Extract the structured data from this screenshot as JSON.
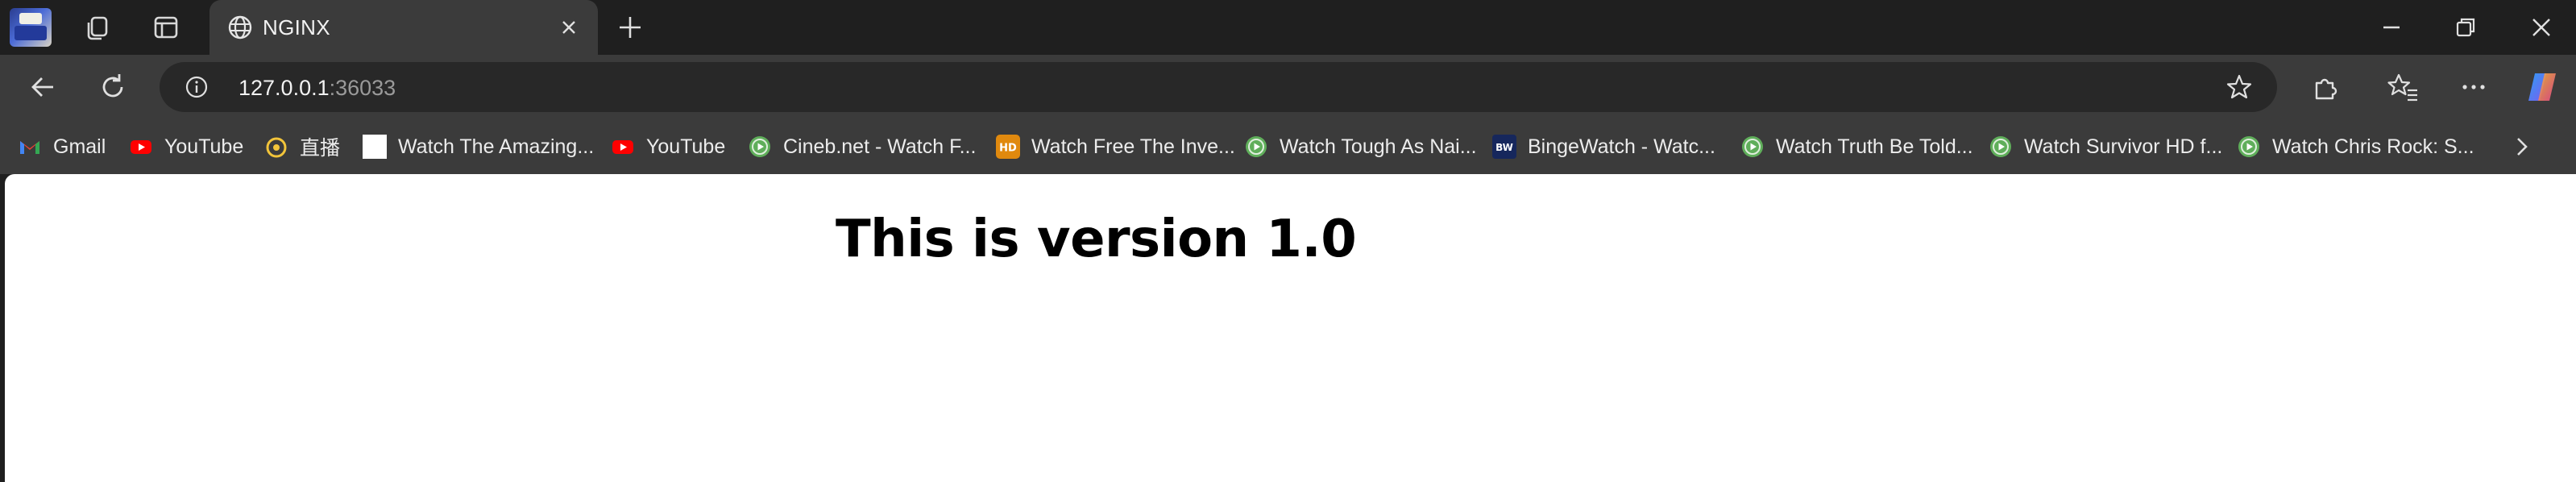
{
  "browser": {
    "tabs": [
      {
        "title": "NGINX",
        "active": true
      }
    ],
    "address_bar": {
      "host": "127.0.0.1",
      "port": ":36033"
    },
    "bookmarks": [
      {
        "label": "Gmail",
        "icon": "gmail-icon"
      },
      {
        "label": "YouTube",
        "icon": "youtube-icon"
      },
      {
        "label": "直播",
        "icon": "live-stream-icon"
      },
      {
        "label": "Watch The Amazing...",
        "icon": "blank-page-icon"
      },
      {
        "label": "YouTube",
        "icon": "youtube-icon"
      },
      {
        "label": "Cineb.net - Watch F...",
        "icon": "play-circle-icon"
      },
      {
        "label": "Watch Free The Inve...",
        "icon": "hd-icon",
        "badge": "HD"
      },
      {
        "label": "Watch Tough As Nai...",
        "icon": "play-circle-icon"
      },
      {
        "label": "BingeWatch - Watc...",
        "icon": "bingewatch-icon",
        "badge": "BW"
      },
      {
        "label": "Watch Truth Be Told...",
        "icon": "play-circle-icon"
      },
      {
        "label": "Watch Survivor HD f...",
        "icon": "play-circle-icon"
      },
      {
        "label": "Watch Chris Rock: S...",
        "icon": "play-circle-icon"
      }
    ]
  },
  "page": {
    "heading": "This is version 1.0"
  },
  "colors": {
    "chrome_dark": "#1f1f1f",
    "chrome_toolbar": "#3b3b3b",
    "omnibox": "#282828",
    "page_background": "#ffffff"
  }
}
